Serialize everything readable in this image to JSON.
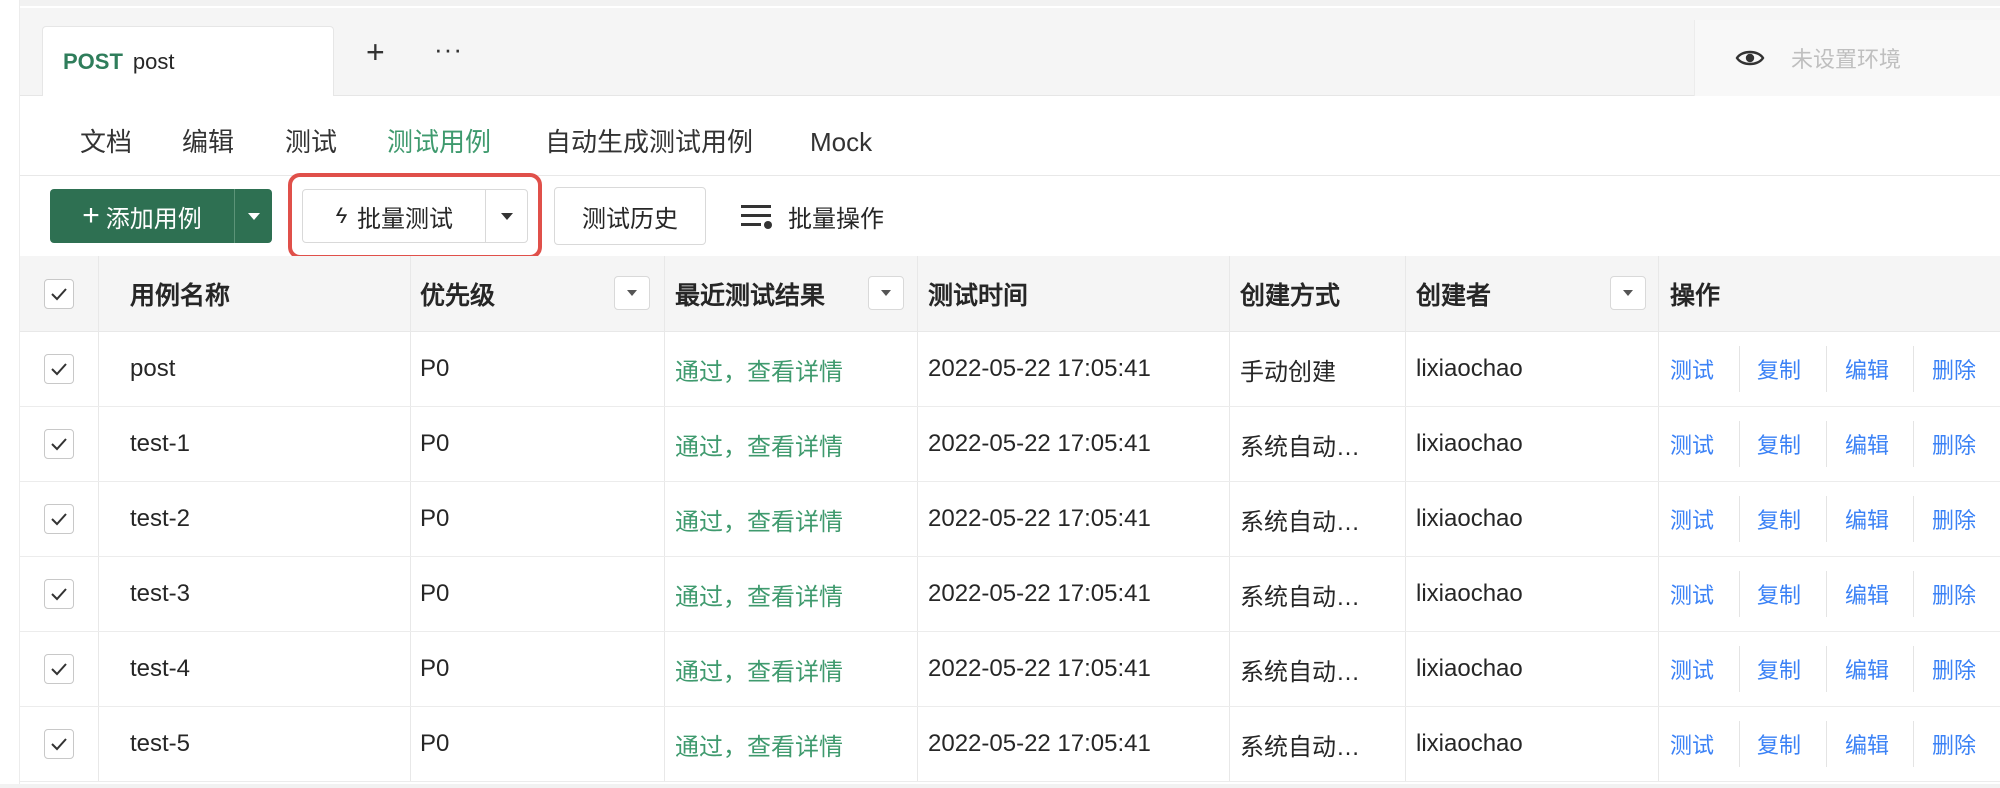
{
  "request_tab": {
    "method": "POST",
    "name": "post"
  },
  "tabbar": {
    "plus": "+",
    "more": "···"
  },
  "environment": {
    "placeholder": "未设置环境"
  },
  "subtabs": [
    {
      "label": "文档"
    },
    {
      "label": "编辑"
    },
    {
      "label": "测试"
    },
    {
      "label": "测试用例",
      "active": true
    },
    {
      "label": "自动生成测试用例"
    },
    {
      "label": "Mock"
    }
  ],
  "toolbar": {
    "add_label": "添加用例",
    "add_plus": "+",
    "batch_test_label": "批量测试",
    "batch_icon": "ϟ",
    "history_label": "测试历史",
    "bulk_ops_label": "批量操作"
  },
  "table": {
    "headers": {
      "name": "用例名称",
      "priority": "优先级",
      "last_result": "最近测试结果",
      "test_time": "测试时间",
      "created_by_method": "创建方式",
      "creator": "创建者",
      "actions": "操作"
    },
    "action_labels": {
      "test": "测试",
      "copy": "复制",
      "edit": "编辑",
      "delete": "删除"
    },
    "rows": [
      {
        "name": "post",
        "priority": "P0",
        "result": "通过，查看详情",
        "time": "2022-05-22 17:05:41",
        "method": "手动创建",
        "creator": "lixiaochao"
      },
      {
        "name": "test-1",
        "priority": "P0",
        "result": "通过，查看详情",
        "time": "2022-05-22 17:05:41",
        "method": "系统自动…",
        "creator": "lixiaochao"
      },
      {
        "name": "test-2",
        "priority": "P0",
        "result": "通过，查看详情",
        "time": "2022-05-22 17:05:41",
        "method": "系统自动…",
        "creator": "lixiaochao"
      },
      {
        "name": "test-3",
        "priority": "P0",
        "result": "通过，查看详情",
        "time": "2022-05-22 17:05:41",
        "method": "系统自动…",
        "creator": "lixiaochao"
      },
      {
        "name": "test-4",
        "priority": "P0",
        "result": "通过，查看详情",
        "time": "2022-05-22 17:05:41",
        "method": "系统自动…",
        "creator": "lixiaochao"
      },
      {
        "name": "test-5",
        "priority": "P0",
        "result": "通过，查看详情",
        "time": "2022-05-22 17:05:41",
        "method": "系统自动…",
        "creator": "lixiaochao"
      }
    ]
  },
  "colors": {
    "accent": "#2e7052",
    "pass": "#3f9a6e",
    "link": "#3b82f6",
    "highlight": "#e0504a"
  }
}
